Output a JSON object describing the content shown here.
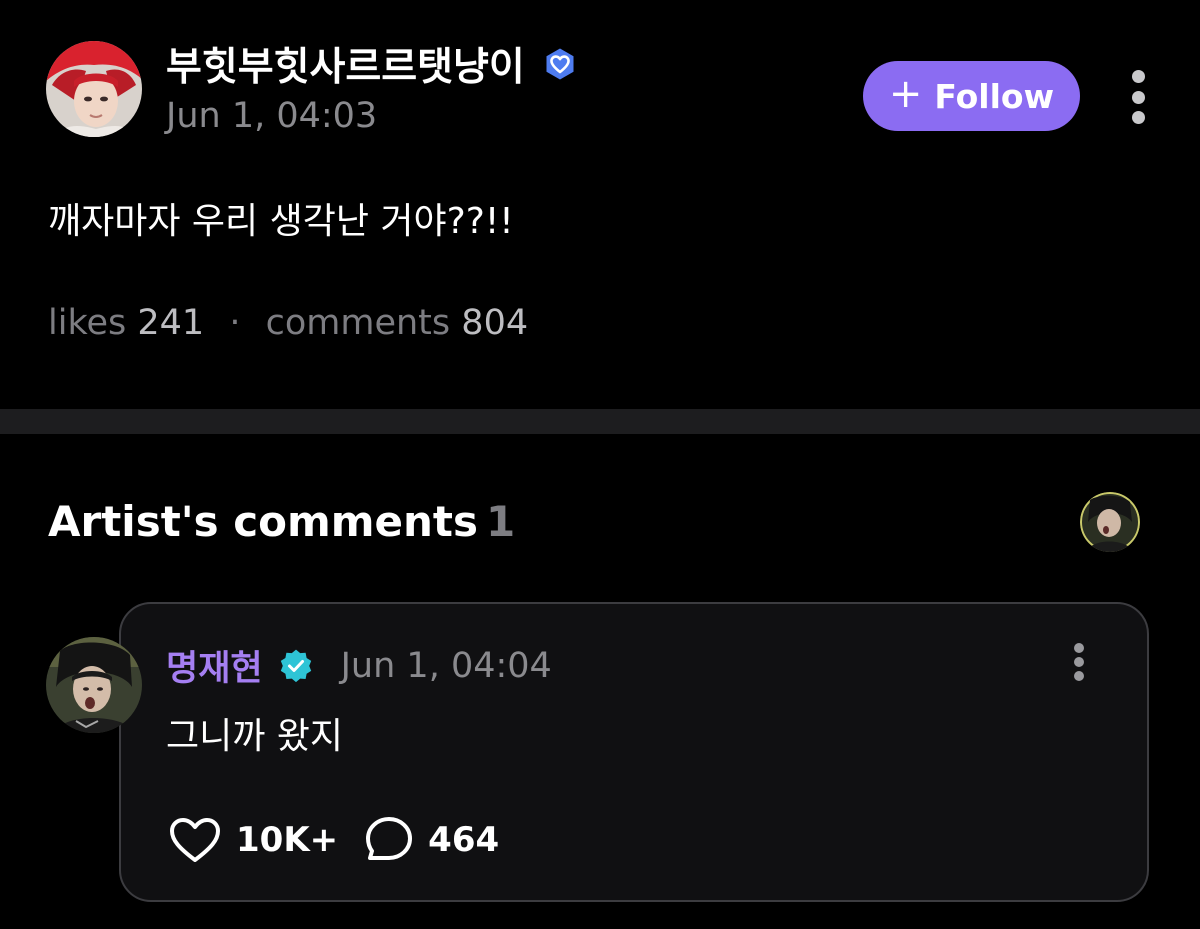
{
  "post": {
    "author_name": "부힛부힛사르르탯냥이",
    "timestamp": "Jun 1, 04:03",
    "body": "깨자마자 우리 생각난 거야??!!",
    "follow_button": {
      "icon": "+",
      "label": "Follow"
    },
    "stats": {
      "likes_label": "likes",
      "likes_count": "241",
      "separator": "·",
      "comments_label": "comments",
      "comments_count": "804"
    }
  },
  "artist_comments": {
    "heading": "Artist's comments",
    "count": "1",
    "comments": [
      {
        "author_name": "명재현",
        "timestamp": "Jun 1, 04:04",
        "body": "그니까 왔지",
        "likes": "10K+",
        "replies": "464"
      }
    ]
  },
  "icons": {
    "author_badge": "heart-badge-icon",
    "verified": "verified-check-icon",
    "more": "more-vertical-icon",
    "like": "heart-outline-icon",
    "reply": "speech-bubble-icon"
  },
  "colors": {
    "background": "#000000",
    "follow_button": "#8b6cf2",
    "artist_name": "#a57ff2",
    "verified_badge": "#2ec4d6",
    "author_badge": "#4e7cf0",
    "muted_text": "#8a8a8e",
    "divider": "#1d1d1f",
    "card_border": "#3c3c40"
  }
}
